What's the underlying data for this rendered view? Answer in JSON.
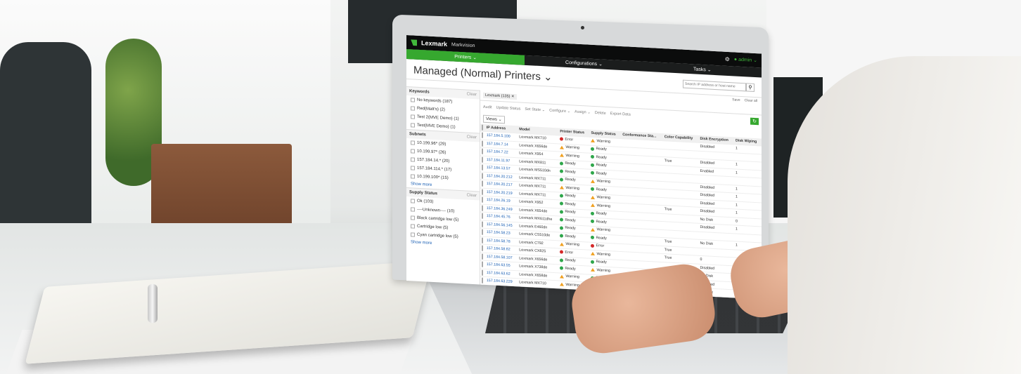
{
  "header": {
    "brand": "Lexmark",
    "product": "Markvision",
    "user": "admin"
  },
  "nav": {
    "tabs": [
      "Printers ⌄",
      "Configurations ⌄",
      "Tasks ⌄"
    ]
  },
  "page": {
    "title": "Managed (Normal) Printers ⌄",
    "search_placeholder": "Search IP address or host name",
    "save": "Save",
    "clear_all": "Clear all"
  },
  "sidebar": {
    "keywords": {
      "title": "Keywords",
      "clear": "Clear",
      "items": [
        "No keywords (187)",
        "Red(Matt's) (2)",
        "Test 2(MVE Demo) (1)",
        "Test(MVE Demo) (1)"
      ]
    },
    "subnets": {
      "title": "Subnets",
      "clear": "Clear",
      "items": [
        "10.199.96* (29)",
        "10.199.97* (26)",
        "157.184.14.* (20)",
        "157.184.114.* (17)",
        "10.199.100* (15)"
      ],
      "show_more": "Show more"
    },
    "supply": {
      "title": "Supply Status",
      "clear": "Clear",
      "items": [
        "Ok (103)",
        "----Unknown---- (10)",
        "Black cartridge low (5)",
        "Cartridge low (5)",
        "Cyan cartridge low (5)"
      ],
      "show_more": "Show more"
    }
  },
  "main": {
    "chip": "Lexmark (135)",
    "toolbar": [
      "Audit",
      "Update Status",
      "Set State ⌄",
      "Configure ⌄",
      "Assign ⌄",
      "Delete",
      "Export Data"
    ],
    "views": "Views ⌄",
    "columns": [
      "IP Address",
      "Model",
      "Printer Status",
      "Supply Status",
      "Conformance Sta...",
      "Color Capability",
      "Disk Encryption",
      "Disk Wiping"
    ],
    "rows": [
      {
        "ip": "157.184.5.100",
        "model": "Lexmark MX710",
        "ps": "Error",
        "ss": "Warning",
        "cc": "",
        "de": "Disabled",
        "dw": "1"
      },
      {
        "ip": "157.184.7.14",
        "model": "Lexmark X656de",
        "ps": "Warning",
        "ss": "Ready",
        "cc": "",
        "de": "",
        "dw": ""
      },
      {
        "ip": "157.184.7.22",
        "model": "Lexmark X954",
        "ps": "Warning",
        "ss": "Ready",
        "cc": "True",
        "de": "Disabled",
        "dw": "1"
      },
      {
        "ip": "157.184.11.97",
        "model": "Lexmark MX811",
        "ps": "Ready",
        "ss": "Ready",
        "cc": "",
        "de": "Enabled",
        "dw": "1"
      },
      {
        "ip": "157.184.13.57",
        "model": "Lexmark MS510dn",
        "ps": "Ready",
        "ss": "Ready",
        "cc": "",
        "de": "",
        "dw": ""
      },
      {
        "ip": "157.184.20.212",
        "model": "Lexmark MX711",
        "ps": "Ready",
        "ss": "Warning",
        "cc": "",
        "de": "Disabled",
        "dw": "1"
      },
      {
        "ip": "157.184.20.217",
        "model": "Lexmark MX711",
        "ps": "Warning",
        "ss": "Ready",
        "cc": "",
        "de": "Disabled",
        "dw": "1"
      },
      {
        "ip": "157.184.20.219",
        "model": "Lexmark MX711",
        "ps": "Ready",
        "ss": "Warning",
        "cc": "",
        "de": "Disabled",
        "dw": "1"
      },
      {
        "ip": "157.184.26.19",
        "model": "Lexmark X952",
        "ps": "Ready",
        "ss": "Warning",
        "cc": "True",
        "de": "Disabled",
        "dw": "1"
      },
      {
        "ip": "157.184.36.249",
        "model": "Lexmark X654de",
        "ps": "Ready",
        "ss": "Ready",
        "cc": "",
        "de": "No Disk",
        "dw": "0"
      },
      {
        "ip": "157.184.45.76",
        "model": "Lexmark MX611dhe",
        "ps": "Ready",
        "ss": "Ready",
        "cc": "",
        "de": "Disabled",
        "dw": "1"
      },
      {
        "ip": "157.184.56.145",
        "model": "Lexmark E460dn",
        "ps": "Ready",
        "ss": "Warning",
        "cc": "",
        "de": "",
        "dw": ""
      },
      {
        "ip": "157.184.58.23",
        "model": "Lexmark CS510de",
        "ps": "Ready",
        "ss": "Ready",
        "cc": "True",
        "de": "No Disk",
        "dw": "1"
      },
      {
        "ip": "157.184.58.78",
        "model": "Lexmark C792",
        "ps": "Warning",
        "ss": "Error",
        "cc": "True",
        "de": "",
        "dw": ""
      },
      {
        "ip": "157.184.58.82",
        "model": "Lexmark CX825",
        "ps": "Error",
        "ss": "Warning",
        "cc": "True",
        "de": "0",
        "dw": ""
      },
      {
        "ip": "157.184.58.107",
        "model": "Lexmark X656de",
        "ps": "Ready",
        "ss": "Ready",
        "cc": "",
        "de": "Disabled",
        "dw": "0"
      },
      {
        "ip": "157.184.63.55",
        "model": "Lexmark X738de",
        "ps": "Ready",
        "ss": "Warning",
        "cc": "True",
        "de": "No Disk",
        "dw": "0"
      },
      {
        "ip": "157.184.63.62",
        "model": "Lexmark X658de",
        "ps": "Warning",
        "ss": "Ready",
        "cc": "",
        "de": "Disabled",
        "dw": "0"
      },
      {
        "ip": "157.184.63.229",
        "model": "Lexmark MX710",
        "ps": "Warning",
        "ss": "Ready",
        "cc": "",
        "de": "No Disk",
        "dw": "1"
      },
      {
        "ip": "157.184.65.178",
        "model": "Lexmark MS315dn",
        "ps": "Ready",
        "ss": "Ready",
        "cc": "",
        "de": "",
        "dw": ""
      }
    ]
  }
}
